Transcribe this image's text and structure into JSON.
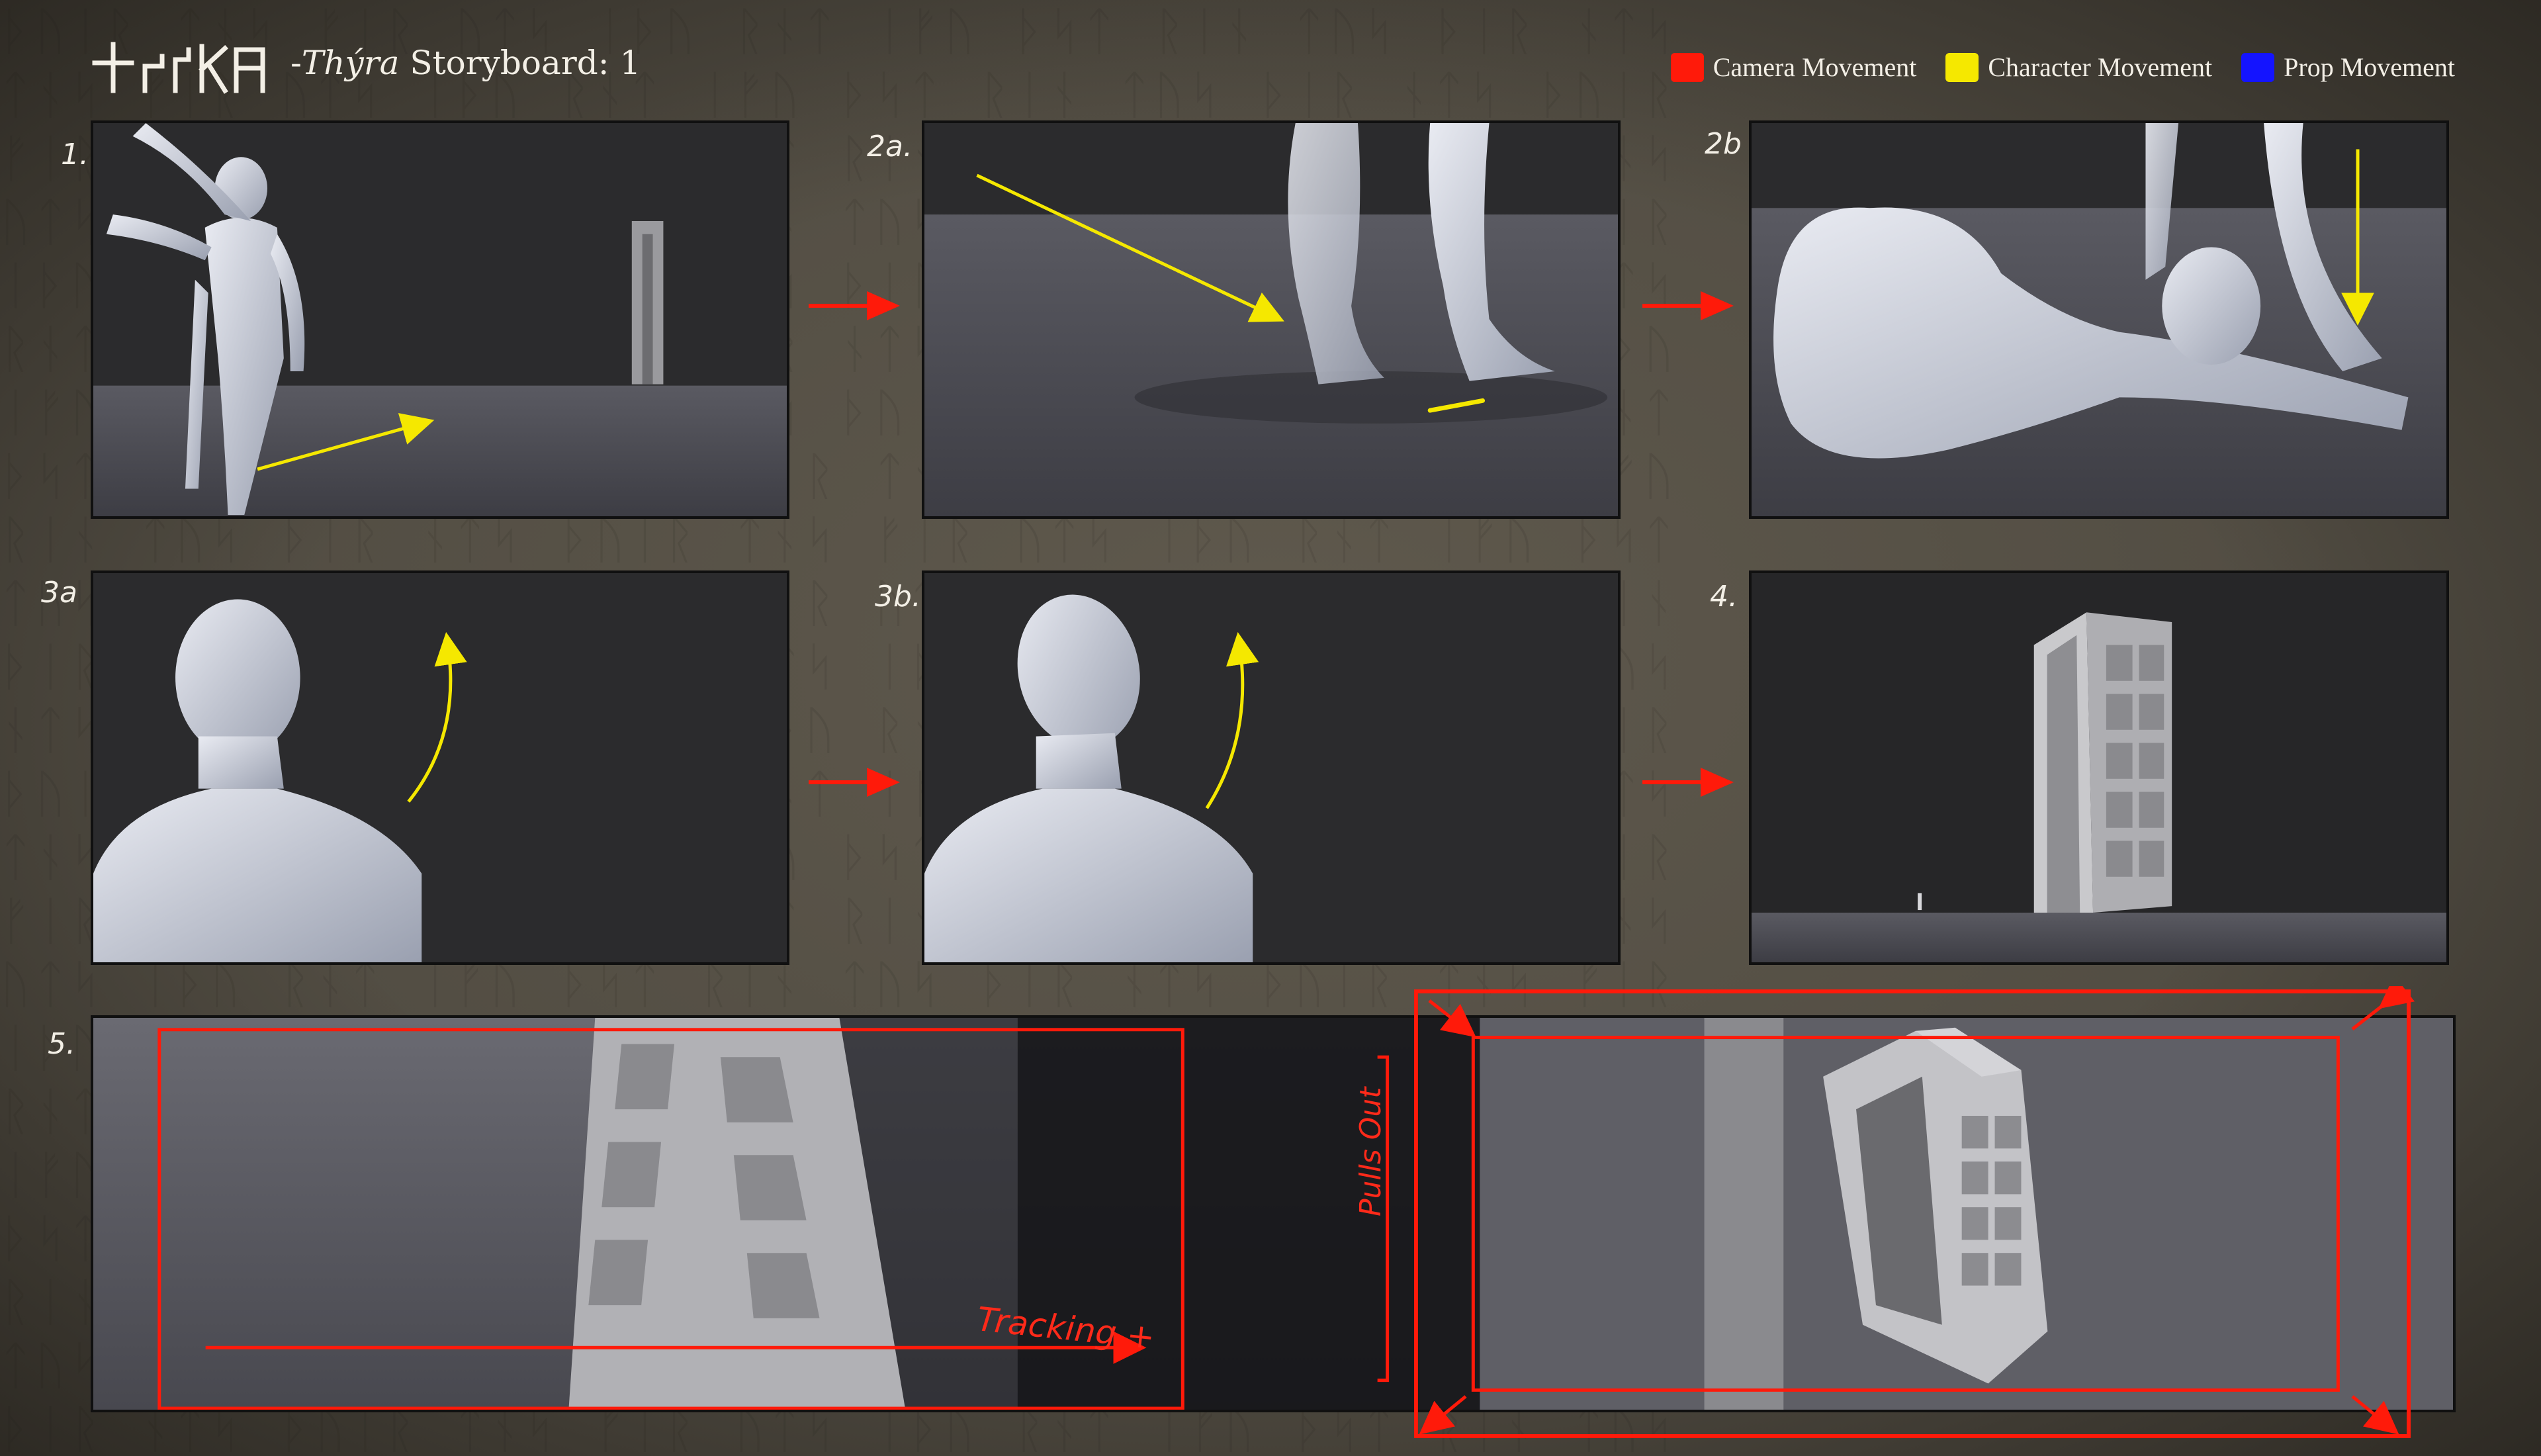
{
  "header": {
    "logo": "logo-glyphs",
    "dash": "-",
    "title_italic": "Thýra",
    "title_rest": " Storyboard: 1"
  },
  "legend": [
    {
      "label": "Camera Movement",
      "color": "#ff1a0a"
    },
    {
      "label": "Character Movement",
      "color": "#f5e800"
    },
    {
      "label": "Prop Movement",
      "color": "#1414ff"
    }
  ],
  "panels": {
    "p1": "1.",
    "p2a": "2a.",
    "p2b": "2b",
    "p3a": "3a",
    "p3b": "3b.",
    "p4": "4.",
    "p5": "5."
  },
  "notes": {
    "tracking": "Tracking +",
    "pulls_out": "Pulls Out"
  }
}
